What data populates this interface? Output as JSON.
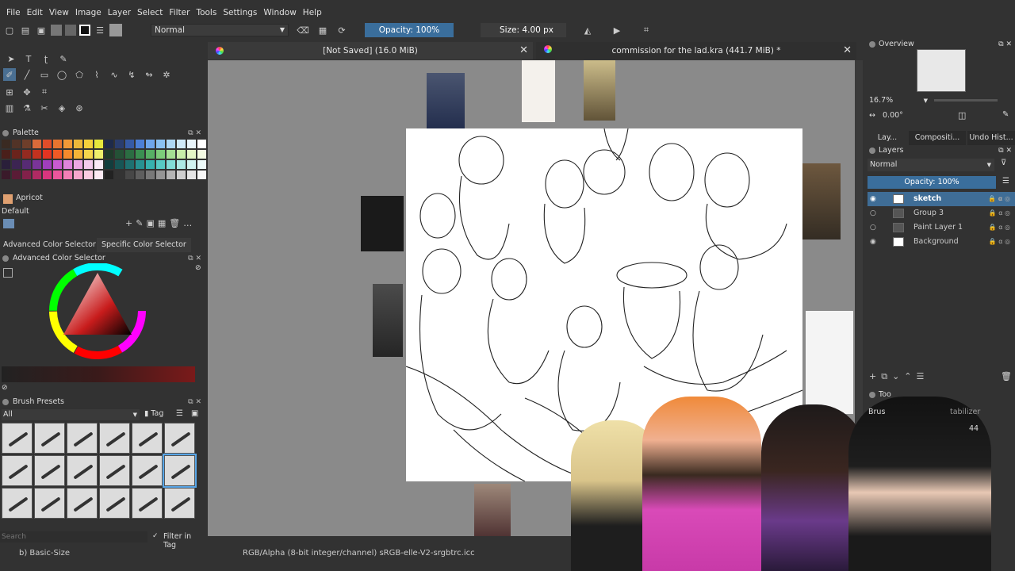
{
  "menu": [
    "File",
    "Edit",
    "View",
    "Image",
    "Layer",
    "Select",
    "Filter",
    "Tools",
    "Settings",
    "Window",
    "Help"
  ],
  "toolbar": {
    "blend_mode": "Normal",
    "opacity": "Opacity: 100%",
    "size": "Size: 4.00 px"
  },
  "tabs": {
    "tab1": "[Not Saved]  (16.0 MiB)",
    "tab2": "commission for the lad.kra  (441.7 MiB) *"
  },
  "palette": {
    "title": "Palette",
    "color_name": "Apricot",
    "set_name": "Default",
    "colors": [
      "#3a2a22",
      "#523327",
      "#6e3e2a",
      "#d96a3a",
      "#e04d2a",
      "#e8752f",
      "#f19a37",
      "#ecb83a",
      "#f4d13c",
      "#e6e73c",
      "#1e2a4a",
      "#2a3d6e",
      "#365aa5",
      "#4c7fd6",
      "#6ea6ec",
      "#8ac1f2",
      "#aed8f5",
      "#cfe9f8",
      "#e9f5fb",
      "#ffffff",
      "#4a1f1a",
      "#6a231c",
      "#932a20",
      "#c2321f",
      "#e23422",
      "#f05a25",
      "#f48a2c",
      "#f3b437",
      "#f5d74c",
      "#eef06b",
      "#1f3a2a",
      "#245136",
      "#2b6d42",
      "#3a8f51",
      "#56b064",
      "#7ccc7a",
      "#a4df93",
      "#c8eda9",
      "#e5f7c7",
      "#f4fbe3",
      "#2a1f3a",
      "#3c2452",
      "#572b74",
      "#7a3499",
      "#a13ebd",
      "#c85bd2",
      "#de84dc",
      "#eba8e3",
      "#f3cbec",
      "#faeaf6",
      "#123d3d",
      "#175555",
      "#1e7070",
      "#279191",
      "#36b1ae",
      "#57cac4",
      "#82dcd7",
      "#ade9e5",
      "#d3f4f1",
      "#eefbfa",
      "#3a1a2a",
      "#5a1c36",
      "#82214a",
      "#b02a63",
      "#d8357e",
      "#ec569c",
      "#f37fb6",
      "#f7a7cd",
      "#fbcde2",
      "#fdebf4",
      "#222222",
      "#333333",
      "#474747",
      "#5e5e5e",
      "#787878",
      "#959595",
      "#b4b4b4",
      "#cfcfcf",
      "#e6e6e6",
      "#f7f7f7"
    ]
  },
  "color_selector": {
    "tab_advanced": "Advanced Color Selector",
    "tab_specific": "Specific Color Selector",
    "title": "Advanced Color Selector"
  },
  "brush_presets": {
    "title": "Brush Presets",
    "filter": "All",
    "tag": "Tag",
    "search_placeholder": "Search",
    "filter_in_tag": "Filter in Tag"
  },
  "overview": {
    "title": "Overview",
    "zoom": "16.7%",
    "rotation": "0.00°"
  },
  "right_tabs": [
    "Lay...",
    "Compositi...",
    "Undo Hist..."
  ],
  "layers": {
    "title": "Layers",
    "blend_mode": "Normal",
    "opacity": "Opacity:  100%",
    "items": [
      {
        "name": "sketch"
      },
      {
        "name": "Group 3"
      },
      {
        "name": "Paint Layer 1"
      },
      {
        "name": "Background"
      }
    ]
  },
  "tool_options": {
    "title": "Too",
    "brush_label": "Brus",
    "stabilizer": "tabilizer",
    "value": "44"
  },
  "status": {
    "brush": "b) Basic-Size",
    "color_space": "RGB/Alpha (8-bit integer/channel)  sRGB-elle-V2-srgbtrc.icc"
  },
  "colors": {
    "accent": "#3a6e9c",
    "panel": "#323232",
    "canvas_bg": "#8a8a8a"
  }
}
